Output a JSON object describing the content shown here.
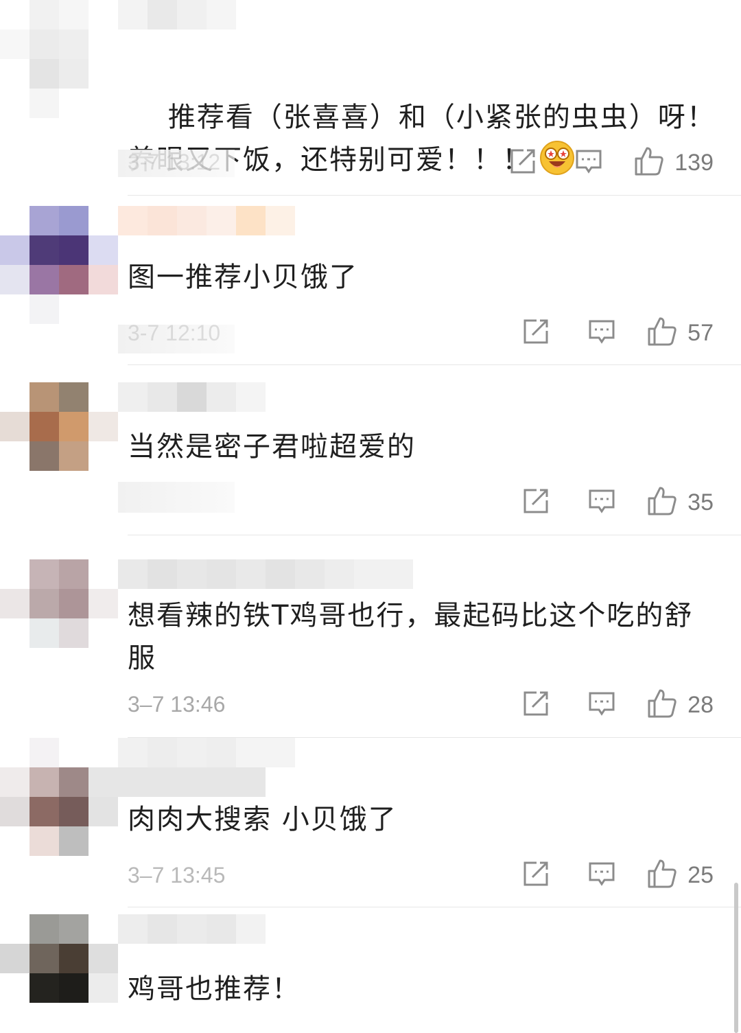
{
  "comments": [
    {
      "text": "推荐看（张喜喜）和（小紧张的虫虫）呀！养眼又下饭，还特别可爱！！！",
      "time": "3-7 13:12",
      "likes": "139",
      "has_emoji": true,
      "emoji_icon": "star-eyes-grin-icon"
    },
    {
      "text": "图一推荐小贝饿了",
      "time": "3-7 12:10",
      "likes": "57"
    },
    {
      "text": "当然是密子君啦超爱的",
      "time": "",
      "likes": "35"
    },
    {
      "text": "想看辣的铁T鸡哥也行，最起码比这个吃的舒服",
      "time": "3–7 13:46",
      "likes": "28"
    },
    {
      "text": "肉肉大搜索 小贝饿了",
      "time": "3–7 13:45",
      "likes": "25"
    },
    {
      "text": "鸡哥也推荐！",
      "time": "",
      "likes": ""
    }
  ],
  "icons": {
    "share": "share-icon",
    "reply": "reply-icon",
    "like": "thumbs-up-icon"
  },
  "colors": {
    "text": "#1f1f1f",
    "meta": "#a8a8a8",
    "icon": "#8c8c8c",
    "divider": "#e6e6e6"
  }
}
